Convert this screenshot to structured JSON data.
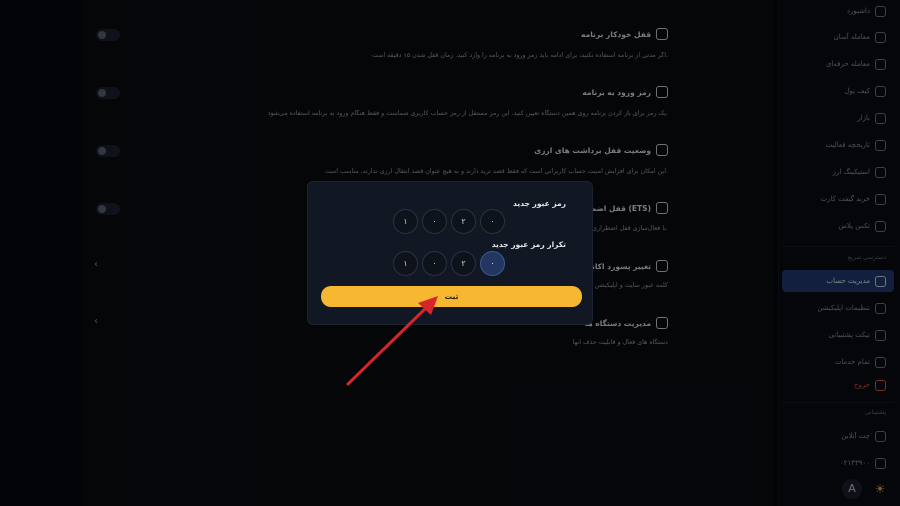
{
  "sidebar": {
    "items": [
      {
        "label": "داشبورد",
        "icon": "dashboard-icon"
      },
      {
        "label": "معامله آسان",
        "icon": "cart-icon"
      },
      {
        "label": "معامله حرفه‌ای",
        "icon": "chart-icon"
      },
      {
        "label": "کیف پول",
        "icon": "wallet-icon"
      },
      {
        "label": "بازار",
        "icon": "market-icon"
      },
      {
        "label": "تاریخچه فعالیت",
        "icon": "history-icon"
      },
      {
        "label": "استیکینگ ارز",
        "icon": "staking-icon"
      },
      {
        "label": "خرید گیفت کارت",
        "icon": "gift-icon"
      },
      {
        "label": "تکس پلاس",
        "icon": "plus-icon"
      }
    ],
    "quick_access_title": "دسترسی سریع",
    "quick_items": [
      {
        "label": "مدیریت حساب",
        "icon": "user-icon",
        "active": true
      },
      {
        "label": "تنظیمات اپلیکیشن",
        "icon": "settings-icon"
      },
      {
        "label": "تیکت پشتیبانی",
        "icon": "ticket-icon"
      },
      {
        "label": "تمام خدمات",
        "icon": "grid-icon"
      },
      {
        "label": "خروج",
        "icon": "logout-icon",
        "danger": true
      }
    ],
    "support_title": "پشتیبانی",
    "support_items": [
      {
        "label": "چت آنلاین",
        "icon": "chat-icon"
      },
      {
        "label": "۰۲۱۴۳۹۰۰",
        "icon": "phone-icon"
      }
    ],
    "lang_label": "A",
    "accent_color": "#243a74"
  },
  "main": {
    "rows": [
      {
        "title": "قفل خودکار برنامه",
        "icon": "lock-icon",
        "desc": "اگر مدتی از برنامه استفاده نکنید، برای ادامه باید رمز ورود به برنامه را وارد کنید. زمان قفل شدن ۱۵ دقیقه است.",
        "control": "toggle"
      },
      {
        "title": "رمز ورود به برنامه",
        "icon": "key-icon",
        "desc": "یک رمز برای باز کردن برنامه روی همین دستگاه تعیین کنید. این رمز مستقل از رمز حساب کاربری شماست و فقط هنگام ورود به برنامه استفاده می‌شود.",
        "control": "toggle"
      },
      {
        "title": "وضعیت قفل برداشت های ارزی",
        "icon": "lock-icon",
        "desc": "این امکان برای افزایش امنیت حساب کاربرانی است که فقط قصد ترید دارند و به هیچ عنوان قصد انتقال ارزی ندارند، مناسب است.",
        "control": "toggle"
      },
      {
        "title": "قفل اضطراری (ETS)",
        "icon": "lock-icon",
        "desc": "با فعال‌سازی قفل اضطراری، ... رمز خود را به شماره ۰۲۱۴۳۹۰۰ پیامک کنید.",
        "control": "toggle"
      },
      {
        "title": "تغییر پسورد اکانت",
        "icon": "password-icon",
        "desc": "کلمه عبور سایت و اپلیکیشن",
        "control": "chevron"
      },
      {
        "title": "مدیریت دستگاه ها",
        "icon": "device-icon",
        "desc": "دستگاه های فعال و قابلیت حذف آنها",
        "control": "chevron"
      }
    ]
  },
  "modal": {
    "new_pin_label": "رمز عبور جدید",
    "new_pin_digits": [
      "۱",
      "۰",
      "۲",
      "۰"
    ],
    "confirm_pin_label": "تکرار رمز عبور جدید",
    "confirm_pin_digits": [
      "۱",
      "۰",
      "۲",
      "۰"
    ],
    "submit_label": "ثبت",
    "submit_color": "#f7b731"
  }
}
